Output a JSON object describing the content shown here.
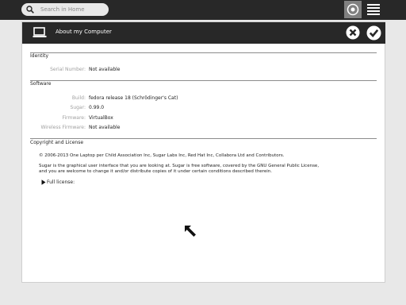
{
  "topbar": {
    "search_placeholder": "Search in Home"
  },
  "dialog": {
    "title": "About my Computer"
  },
  "identity": {
    "heading": "Identity",
    "serial_label": "Serial Number:",
    "serial_value": "Not available"
  },
  "software": {
    "heading": "Software",
    "build_label": "Build:",
    "build_value": "fedora release 18 (Schrödinger's Cat)",
    "sugar_label": "Sugar:",
    "sugar_value": "0.99.0",
    "firmware_label": "Firmware:",
    "firmware_value": "VirtualBox",
    "wireless_label": "Wireless Firmware:",
    "wireless_value": "Not available"
  },
  "license": {
    "heading": "Copyright and License",
    "copyright": "© 2006-2013 One Laptop per Child Association Inc, Sugar Labs Inc, Red Hat Inc, Collabora Ltd and Contributors.",
    "line1": "Sugar is the graphical user interface that you are looking at. Sugar is free software, covered by the GNU General Public License,",
    "line2": "and you are welcome to change it and/or distribute copies of it under certain conditions described therein.",
    "full_license": "Full license:"
  },
  "icons": [
    "search-icon",
    "home-view-icon",
    "list-view-icon",
    "computer-icon",
    "cancel-icon",
    "ok-icon",
    "expander-arrow-icon",
    "cursor-icon"
  ],
  "colors": {
    "toolbar": "#282828",
    "background": "#e8e8e8",
    "panel": "#ffffff"
  }
}
